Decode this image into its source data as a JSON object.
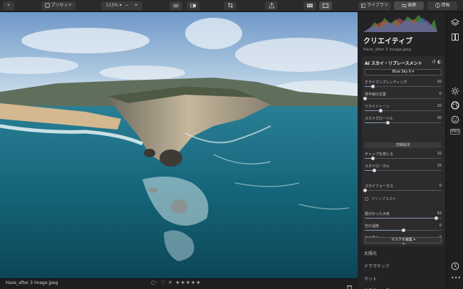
{
  "toolbar": {
    "add_label": "+",
    "presets_label": "プリセット",
    "zoom_label": "113%",
    "zoom_minus": "−",
    "zoom_plus": "+",
    "tabs": [
      {
        "label": "ライブラリ",
        "active": false
      },
      {
        "label": "編集",
        "active": true
      },
      {
        "label": "情報",
        "active": false
      }
    ]
  },
  "panel": {
    "title": "クリエイティブ",
    "subtitle": "Haze_after 3 image.jpeg",
    "card": {
      "title": "AI スカイ・リプレースメント",
      "sky_option": "Blue Sky 6",
      "sliders_top": [
        {
          "label": "ホライズンブレンディング",
          "value": "20",
          "fraction": 0.1
        },
        {
          "label": "地平線の位置",
          "value": "0",
          "fraction": 0.0
        },
        {
          "label": "リライトシーン",
          "value": "20",
          "fraction": 0.2
        },
        {
          "label": "スカイグローバル",
          "value": "30",
          "fraction": 0.3
        }
      ],
      "advanced_label": "詳細設定",
      "sliders_mid": [
        {
          "label": "ギャップを閉じる",
          "value": "10",
          "fraction": 0.1
        },
        {
          "label": "スカイローカル",
          "value": "25",
          "fraction": 0.12
        }
      ],
      "sky_focus": {
        "label": "スカイフォーカス",
        "value": "0",
        "fraction": 0.0
      },
      "flip_label": "フリップスカイ",
      "sliders_bottom": [
        {
          "label": "霞がかった大気",
          "value": "93",
          "fraction": 0.93
        },
        {
          "label": "空の温度",
          "value": "0",
          "fraction": 0.5
        },
        {
          "label": "空の露出",
          "value": "0",
          "fraction": 0.5
        }
      ],
      "mask_label": "マスクを編集"
    },
    "more_tools": [
      "太陽光",
      "ドラマチック",
      "マット",
      "ミスティック"
    ]
  },
  "sidebar_icons": [
    "layers-icon",
    "compare-icon",
    "sun-icon",
    "palette-icon",
    "face-icon",
    "pro-badge",
    "history-icon",
    "more-icon"
  ],
  "sidebar_pro": "PRO",
  "bottom": {
    "filename": "Haze_after 3 image.jpeg",
    "rating": "★★★★★"
  },
  "colors": {
    "accent": "#8a9ab8",
    "panel_bg": "#232325",
    "card_bg": "#2c2c2e"
  }
}
